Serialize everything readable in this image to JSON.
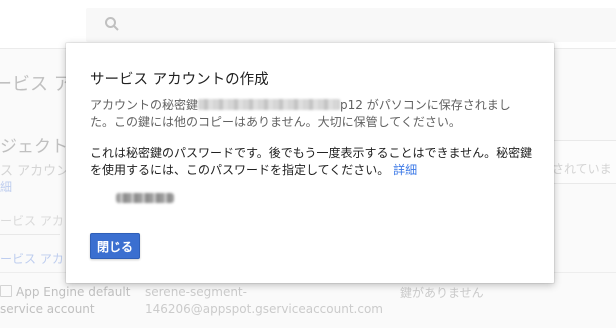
{
  "background": {
    "page_title": "ービス アカ",
    "section_heading": "ジェクト",
    "section_sub": "ス アカウン",
    "section_link": "細",
    "input_placeholder": "ービス アカ",
    "tab_link": "ービス アカ",
    "right_text": "行されていま",
    "row": {
      "name_line1": "App Engine default",
      "name_line2": "service account",
      "email_line1": "serene-segment-",
      "email_line2": "146206@appspot.gserviceaccount.com",
      "status": "鍵がありません"
    }
  },
  "dialog": {
    "title": "サービス アカウントの作成",
    "message_prefix": "アカウントの秘密鍵",
    "message_ext": "p12",
    "message_suffix": " がパソコンに保存されました。この鍵には他のコピーはありません。大切に保管してください。",
    "password_message": "これは秘密鍵のパスワードです。後でもう一度表示することはできません。秘密鍵を使用するには、このパスワードを指定してください。",
    "details_link": "詳細",
    "close_button": "閉じる"
  },
  "colors": {
    "primary_button": "#3b6fd0",
    "link": "#3b78e7"
  },
  "icons": {
    "search": "search-icon"
  }
}
